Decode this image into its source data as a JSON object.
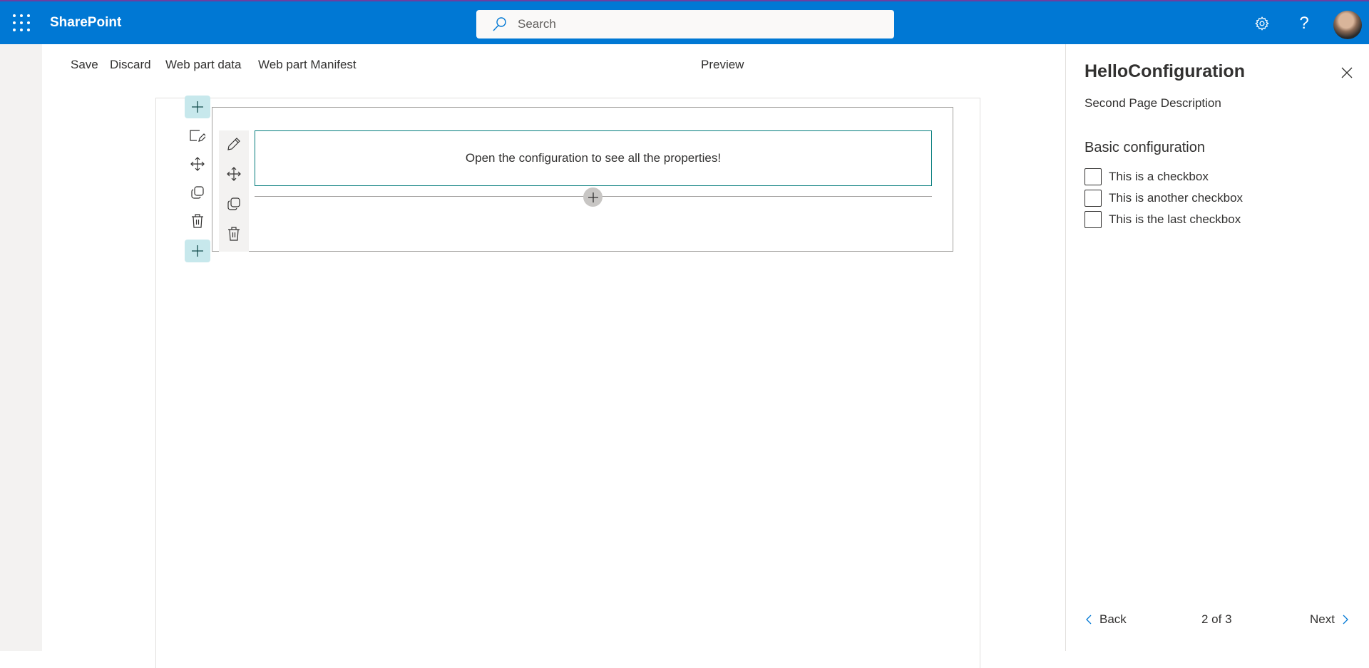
{
  "suite": {
    "brand": "SharePoint",
    "search_placeholder": "Search",
    "icons": [
      "waffle-icon",
      "gear-icon",
      "help-icon",
      "avatar"
    ],
    "colors": {
      "bar": "#0078d4",
      "accent_line": "#6b3fa0"
    }
  },
  "commandbar": {
    "save": "Save",
    "discard": "Discard",
    "webpart_data": "Web part data",
    "webpart_manifest": "Web part Manifest",
    "preview": "Preview"
  },
  "canvas": {
    "webpart_text": "Open the configuration to see all the properties!",
    "section_tools": [
      "edit-section-icon",
      "move-icon",
      "duplicate-icon",
      "delete-icon"
    ],
    "webpart_tools": [
      "edit-icon",
      "move-icon",
      "duplicate-icon",
      "delete-icon"
    ],
    "colors": {
      "selection": "#037c7c",
      "add_button": "#c7e8ec"
    }
  },
  "panel": {
    "title": "HelloConfiguration",
    "description": "Second Page Description",
    "group_name": "Basic configuration",
    "checkboxes": [
      {
        "label": "This is a checkbox",
        "checked": false
      },
      {
        "label": "This is another checkbox",
        "checked": false
      },
      {
        "label": "This is the last checkbox",
        "checked": false
      }
    ],
    "footer": {
      "back": "Back",
      "page_indicator": "2 of 3",
      "next": "Next"
    }
  }
}
